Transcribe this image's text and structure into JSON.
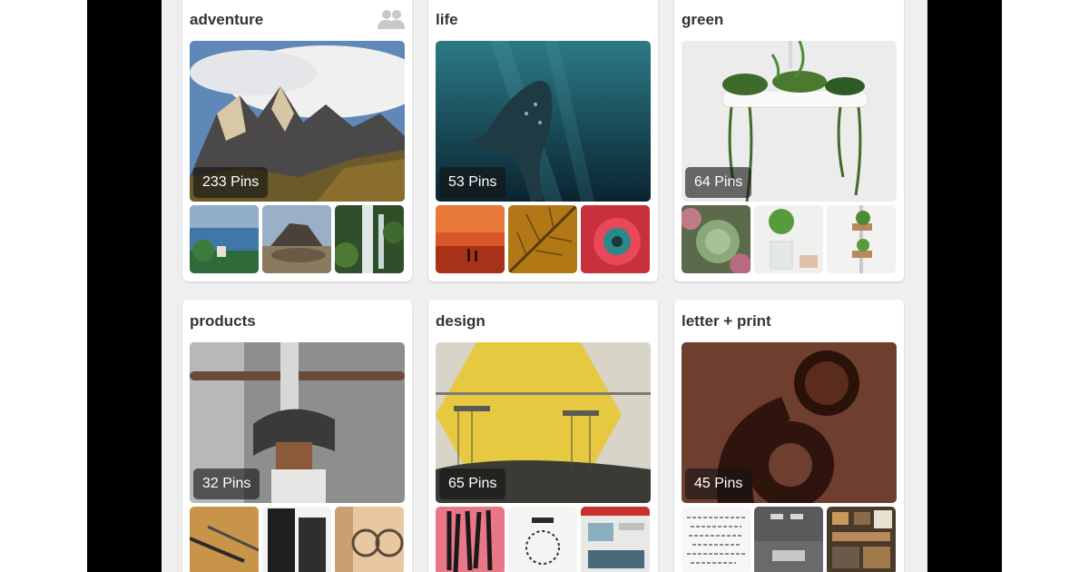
{
  "boards": [
    {
      "name": "adventure",
      "pins": "233 Pins",
      "collaborative": true,
      "icon": "group-people-icon"
    },
    {
      "name": "life",
      "pins": "53 Pins"
    },
    {
      "name": "green",
      "pins": "64 Pins"
    },
    {
      "name": "products",
      "pins": "32 Pins"
    },
    {
      "name": "design",
      "pins": "65 Pins"
    },
    {
      "name": "letter + print",
      "pins": "45 Pins"
    }
  ],
  "colors": {
    "device_bezel": "#000000",
    "screen_bg": "#efefef",
    "card_bg": "#ffffff",
    "title_text": "#333333",
    "badge_bg": "rgba(20,20,20,0.62)"
  }
}
